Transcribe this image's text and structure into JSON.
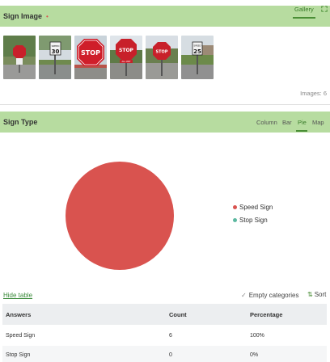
{
  "sign_image": {
    "title": "Sign Image",
    "required_marker": "•",
    "gallery_tab": "Gallery",
    "expand_icon": "expand-icon",
    "thumbnails": [
      {
        "name": "stop-sign-photo-1"
      },
      {
        "name": "speed-limit-30-photo"
      },
      {
        "name": "stop-sign-photo-2"
      },
      {
        "name": "stop-sign-all-way-photo"
      },
      {
        "name": "stop-sign-photo-3"
      },
      {
        "name": "speed-limit-25-photo"
      }
    ],
    "images_count": "Images: 6"
  },
  "sign_type": {
    "title": "Sign Type",
    "chart_tabs": [
      "Column",
      "Bar",
      "Pie",
      "Map"
    ],
    "active_tab": "Pie",
    "legend": [
      {
        "label": "Speed Sign",
        "color": "#d9534f"
      },
      {
        "label": "Stop Sign",
        "color": "#5cb8a0"
      }
    ],
    "controls": {
      "hide_table": "Hide table",
      "empty_categories": "Empty categories",
      "sort": "Sort"
    },
    "table": {
      "headers": [
        "Answers",
        "Count",
        "Percentage"
      ],
      "rows": [
        [
          "Speed Sign",
          "6",
          "100%"
        ],
        [
          "Stop Sign",
          "0",
          "0%"
        ]
      ]
    }
  },
  "chart_data": {
    "type": "pie",
    "categories": [
      "Speed Sign",
      "Stop Sign"
    ],
    "values": [
      6,
      0
    ],
    "colors": [
      "#d9534f",
      "#5cb8a0"
    ]
  }
}
